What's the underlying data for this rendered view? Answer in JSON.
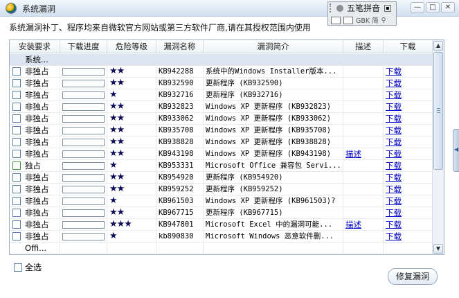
{
  "window": {
    "title": "系统漏洞",
    "controls": [
      "—",
      "□",
      "✕"
    ]
  },
  "ime": {
    "name": "五笔拼音",
    "row2": "GBK 简"
  },
  "description": "系统漏洞补丁、程序均来自微软官方网站或第三方软件厂商,请在其授权范围内使用",
  "table": {
    "headers": [
      "安装要求",
      "下载进度",
      "危险等级",
      "漏洞名称",
      "漏洞简介",
      "描述",
      "下载"
    ],
    "group_label": "系统...",
    "rows": [
      {
        "req": "非独占",
        "risk": "★★",
        "kb": "KB942288",
        "summary": "系统中的Windows Installer版本...",
        "desc": "",
        "dl": "下载",
        "green": false
      },
      {
        "req": "非独占",
        "risk": "★★",
        "kb": "KB932590",
        "summary": "更新程序 (KB932590)",
        "desc": "",
        "dl": "下载",
        "green": false
      },
      {
        "req": "非独占",
        "risk": "★",
        "kb": "KB932716",
        "summary": "更新程序 (KB932716)",
        "desc": "",
        "dl": "下载",
        "green": false
      },
      {
        "req": "非独占",
        "risk": "★★",
        "kb": "KB932823",
        "summary": "Windows XP 更新程序 (KB932823)",
        "desc": "",
        "dl": "下载",
        "green": false
      },
      {
        "req": "非独占",
        "risk": "★★",
        "kb": "KB933062",
        "summary": "Windows XP 更新程序 (KB933062)",
        "desc": "",
        "dl": "下载",
        "green": false
      },
      {
        "req": "非独占",
        "risk": "★★",
        "kb": "KB935708",
        "summary": "Windows XP 更新程序 (KB935708)",
        "desc": "",
        "dl": "下载",
        "green": false
      },
      {
        "req": "非独占",
        "risk": "★★",
        "kb": "KB938828",
        "summary": "Windows XP 更新程序 (KB938828)",
        "desc": "",
        "dl": "下载",
        "green": false
      },
      {
        "req": "非独占",
        "risk": "★★",
        "kb": "KB943198",
        "summary": "Windows XP 更新程序 (KB943198)",
        "desc": "描述",
        "dl": "下载",
        "green": false
      },
      {
        "req": "独占",
        "risk": "★",
        "kb": "KB953331",
        "summary": "Microsoft Office 兼容包 Servi...",
        "desc": "",
        "dl": "下载",
        "green": true
      },
      {
        "req": "非独占",
        "risk": "★★",
        "kb": "KB954920",
        "summary": "更新程序 (KB954920)",
        "desc": "",
        "dl": "下载",
        "green": false
      },
      {
        "req": "非独占",
        "risk": "★★",
        "kb": "KB959252",
        "summary": "更新程序 (KB959252)",
        "desc": "",
        "dl": "下载",
        "green": false
      },
      {
        "req": "非独占",
        "risk": "★",
        "kb": "KB961503",
        "summary": "Windows XP 更新程序 (KB961503)?",
        "desc": "",
        "dl": "下载",
        "green": false
      },
      {
        "req": "非独占",
        "risk": "★★",
        "kb": "KB967715",
        "summary": "更新程序 (KB967715)",
        "desc": "",
        "dl": "下载",
        "green": false
      },
      {
        "req": "非独占",
        "risk": "★★★",
        "kb": "KB947801",
        "summary": "Microsoft Excel 中的漏洞可能...",
        "desc": "描述",
        "dl": "下载",
        "green": false
      },
      {
        "req": "非独占",
        "risk": "★",
        "kb": "kb890830",
        "summary": "Microsoft Windows 恶意软件删...",
        "desc": "",
        "dl": "下载",
        "green": false
      }
    ],
    "last_row_label": "Offi..."
  },
  "footer": {
    "select_all": "全选",
    "repair": "修复漏洞"
  }
}
